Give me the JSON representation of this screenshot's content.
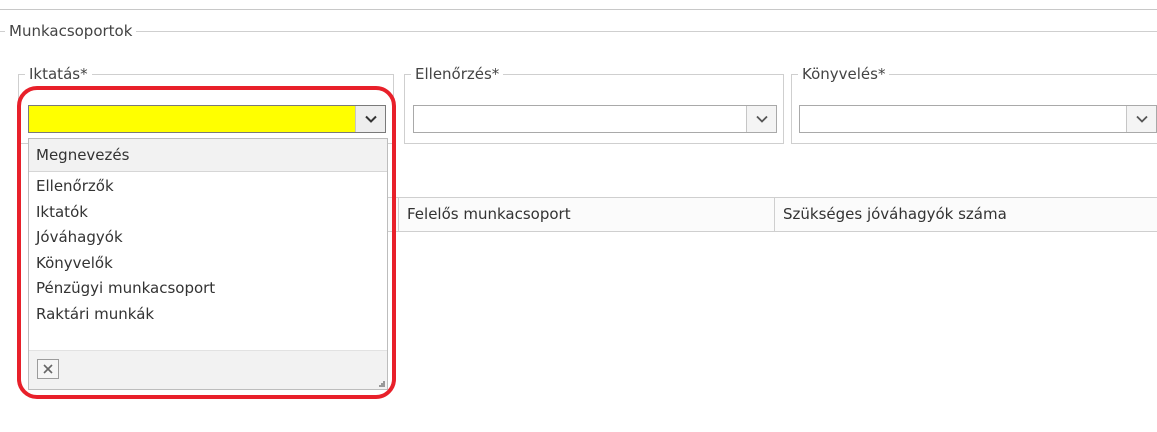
{
  "groups": {
    "main_title": "Munkacsoportok",
    "iktatas_title": "Iktatás*",
    "ellenorzes_title": "Ellenőrzés*",
    "konyveles_title": "Könyvelés*"
  },
  "combos": {
    "iktatas_value": "",
    "ellenorzes_value": "",
    "konyveles_value": ""
  },
  "grid": {
    "columns": [
      "Felelős munkacsoport",
      "Szükséges jóváhagyók száma"
    ]
  },
  "dropdown": {
    "header": "Megnevezés",
    "items": [
      "Ellenőrzők",
      "Iktatók",
      "Jóváhagyók",
      "Könyvelők",
      "Pénzügyi munkacsoport",
      "Raktári munkák"
    ]
  },
  "icons": {
    "dropdown_arrow": "chevron-down-icon",
    "clear": "close-icon"
  },
  "colors": {
    "active_field": "#ffff00",
    "highlight": "#e8202a"
  }
}
